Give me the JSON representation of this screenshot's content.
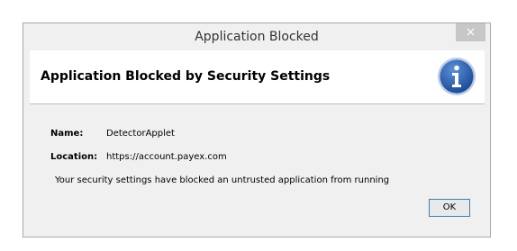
{
  "window": {
    "title": "Application Blocked",
    "close_glyph": "×"
  },
  "header": {
    "title": "Application Blocked by Security Settings",
    "icon": "info-icon",
    "icon_color": "#2b5faa"
  },
  "details": {
    "name_label": "Name:",
    "name_value": "DetectorApplet",
    "location_label": "Location:",
    "location_value": "https://account.payex.com"
  },
  "message": "Your security settings have blocked an untrusted application from running",
  "buttons": {
    "ok_label": "OK"
  }
}
